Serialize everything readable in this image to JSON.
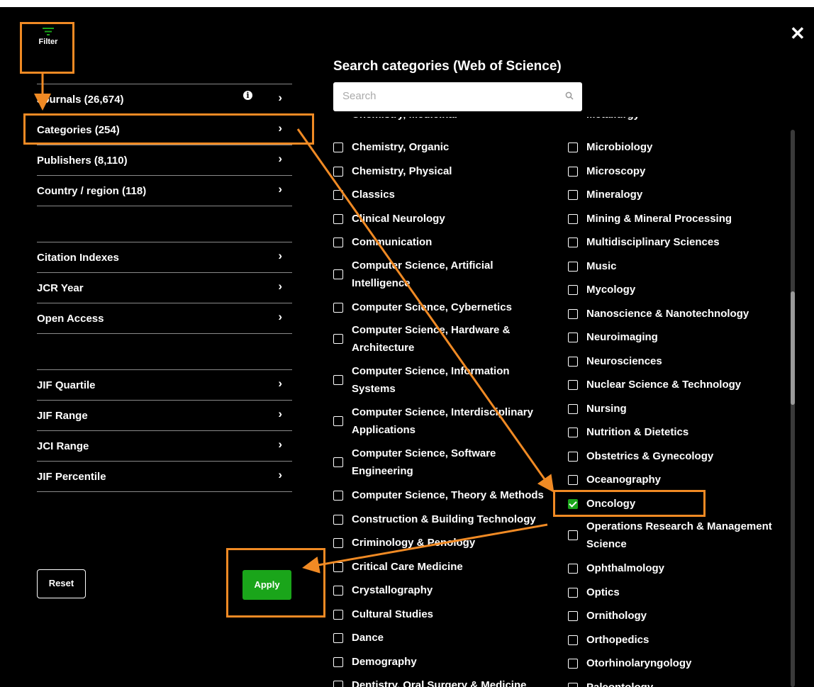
{
  "filter_label": "Filter",
  "close_glyph": "✕",
  "nav": {
    "group1": [
      {
        "label": "Journals (26,674)",
        "has_info": true
      },
      {
        "label": "Categories (254)"
      },
      {
        "label": "Publishers (8,110)"
      },
      {
        "label": "Country / region (118)"
      }
    ],
    "group2": [
      {
        "label": "Citation Indexes"
      },
      {
        "label": "JCR Year"
      },
      {
        "label": "Open Access"
      }
    ],
    "group3": [
      {
        "label": "JIF Quartile"
      },
      {
        "label": "JIF Range"
      },
      {
        "label": "JCI Range"
      },
      {
        "label": "JIF Percentile"
      }
    ],
    "chevron": "›",
    "info_glyph": "i"
  },
  "buttons": {
    "reset": "Reset",
    "apply": "Apply"
  },
  "panel": {
    "title": "Search categories (Web of Science)",
    "search_placeholder": "Search"
  },
  "categories_left": [
    {
      "label": "Chemistry, Organic"
    },
    {
      "label": "Chemistry, Physical"
    },
    {
      "label": "Classics"
    },
    {
      "label": "Clinical Neurology"
    },
    {
      "label": "Communication"
    },
    {
      "label": "Computer Science, Artificial Intelligence",
      "lines": 2
    },
    {
      "label": "Computer Science, Cybernetics"
    },
    {
      "label": "Computer Science, Hardware & Architecture",
      "lines": 2
    },
    {
      "label": "Computer Science, Information Systems",
      "lines": 2
    },
    {
      "label": "Computer Science, Interdisciplinary Applications",
      "lines": 2
    },
    {
      "label": "Computer Science, Software Engineering",
      "lines": 2
    },
    {
      "label": "Computer Science, Theory & Methods"
    },
    {
      "label": "Construction & Building Technology"
    },
    {
      "label": "Criminology & Penology"
    },
    {
      "label": "Critical Care Medicine"
    },
    {
      "label": "Crystallography"
    },
    {
      "label": "Cultural Studies"
    },
    {
      "label": "Dance"
    },
    {
      "label": "Demography"
    },
    {
      "label": "Dentistry, Oral Surgery & Medicine"
    }
  ],
  "categories_right": [
    {
      "label": "Microbiology"
    },
    {
      "label": "Microscopy"
    },
    {
      "label": "Mineralogy"
    },
    {
      "label": "Mining & Mineral Processing"
    },
    {
      "label": "Multidisciplinary Sciences"
    },
    {
      "label": "Music"
    },
    {
      "label": "Mycology"
    },
    {
      "label": "Nanoscience & Nanotechnology"
    },
    {
      "label": "Neuroimaging"
    },
    {
      "label": "Neurosciences"
    },
    {
      "label": "Nuclear Science & Technology"
    },
    {
      "label": "Nursing"
    },
    {
      "label": "Nutrition & Dietetics"
    },
    {
      "label": "Obstetrics & Gynecology"
    },
    {
      "label": "Oceanography"
    },
    {
      "label": "Oncology",
      "checked": true
    },
    {
      "label": "Operations Research & Management Science",
      "lines": 2
    },
    {
      "label": "Ophthalmology"
    },
    {
      "label": "Optics"
    },
    {
      "label": "Ornithology"
    },
    {
      "label": "Orthopedics"
    },
    {
      "label": "Otorhinolaryngology"
    },
    {
      "label": "Paleontology"
    }
  ],
  "colors": {
    "accent_green": "#1aa51a",
    "annotation_orange": "#f08a24",
    "background": "#000000"
  },
  "icons": [
    "filter-icon",
    "close-icon",
    "info-icon",
    "chevron-right-icon",
    "search-icon",
    "checkbox-icon"
  ]
}
